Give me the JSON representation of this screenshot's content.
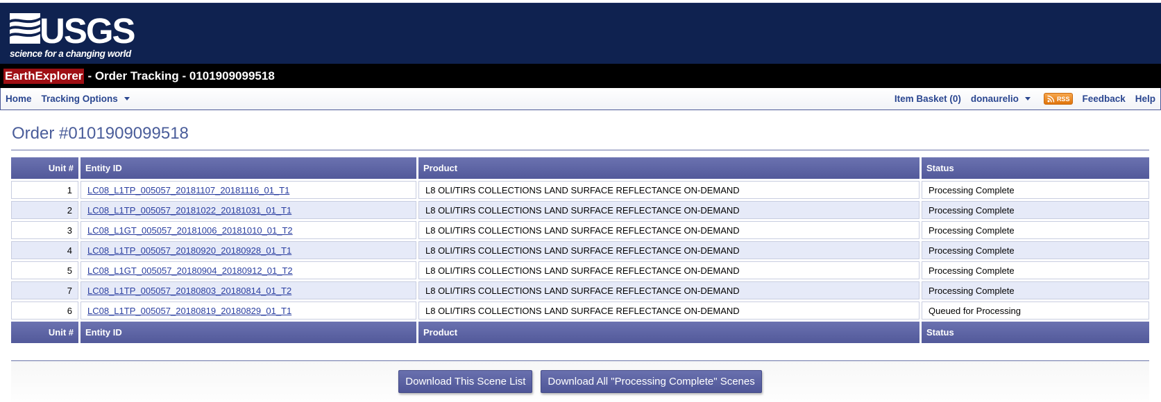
{
  "brand": {
    "logo_text": "USGS",
    "tagline": "science for a changing world"
  },
  "title_bar": {
    "app_name": "EarthExplorer",
    "rest": "- Order Tracking - 0101909099518"
  },
  "menu": {
    "home": "Home",
    "tracking_options": "Tracking Options",
    "item_basket": "Item Basket (0)",
    "user": "donaurelio",
    "rss": "RSS",
    "feedback": "Feedback",
    "help": "Help"
  },
  "order": {
    "heading": "Order #0101909099518"
  },
  "table": {
    "headers": {
      "unit": "Unit #",
      "entity": "Entity ID",
      "product": "Product",
      "status": "Status"
    },
    "rows": [
      {
        "unit": "1",
        "entity": "LC08_L1TP_005057_20181107_20181116_01_T1",
        "product": "L8 OLI/TIRS COLLECTIONS LAND SURFACE REFLECTANCE ON-DEMAND",
        "status": "Processing Complete"
      },
      {
        "unit": "2",
        "entity": "LC08_L1TP_005057_20181022_20181031_01_T1",
        "product": "L8 OLI/TIRS COLLECTIONS LAND SURFACE REFLECTANCE ON-DEMAND",
        "status": "Processing Complete"
      },
      {
        "unit": "3",
        "entity": "LC08_L1GT_005057_20181006_20181010_01_T2",
        "product": "L8 OLI/TIRS COLLECTIONS LAND SURFACE REFLECTANCE ON-DEMAND",
        "status": "Processing Complete"
      },
      {
        "unit": "4",
        "entity": "LC08_L1TP_005057_20180920_20180928_01_T1",
        "product": "L8 OLI/TIRS COLLECTIONS LAND SURFACE REFLECTANCE ON-DEMAND",
        "status": "Processing Complete"
      },
      {
        "unit": "5",
        "entity": "LC08_L1GT_005057_20180904_20180912_01_T2",
        "product": "L8 OLI/TIRS COLLECTIONS LAND SURFACE REFLECTANCE ON-DEMAND",
        "status": "Processing Complete"
      },
      {
        "unit": "7",
        "entity": "LC08_L1TP_005057_20180803_20180814_01_T2",
        "product": "L8 OLI/TIRS COLLECTIONS LAND SURFACE REFLECTANCE ON-DEMAND",
        "status": "Processing Complete"
      },
      {
        "unit": "6",
        "entity": "LC08_L1TP_005057_20180819_20180829_01_T1",
        "product": "L8 OLI/TIRS COLLECTIONS LAND SURFACE REFLECTANCE ON-DEMAND",
        "status": "Queued for Processing"
      }
    ]
  },
  "buttons": {
    "download_scene_list": "Download This Scene List",
    "download_all_complete": "Download All \"Processing Complete\" Scenes"
  },
  "colors": {
    "banner": "#0f2250",
    "title_bar": "#000000",
    "brand_highlight": "#9f0f14",
    "table_header": "#5e65a5",
    "row_alt": "#e6eaf8",
    "link": "#2a3ea0"
  }
}
